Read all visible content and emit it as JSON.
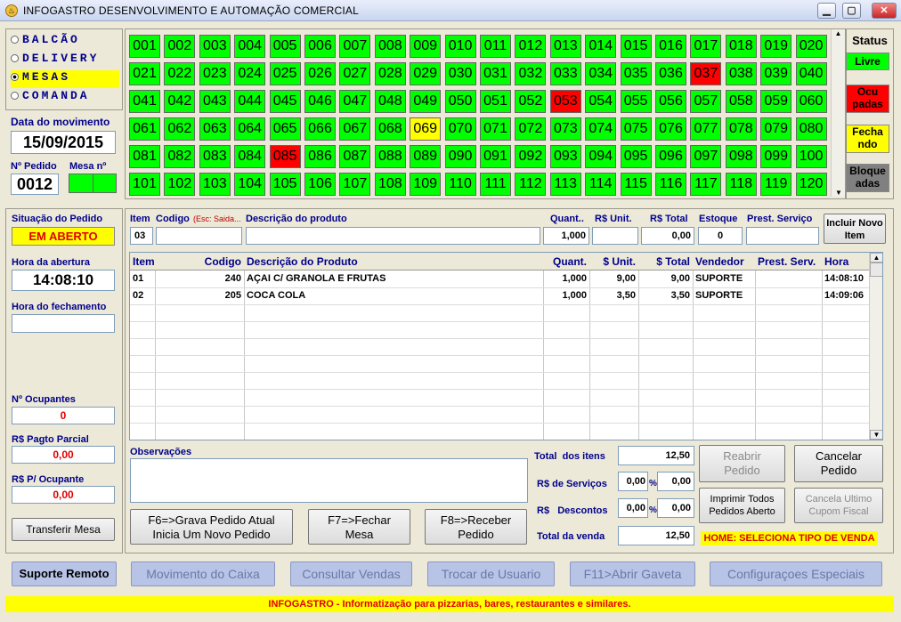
{
  "window": {
    "title": "INFOGASTRO DESENVOLVIMENTO E AUTOMAÇÃO COMERCIAL",
    "minimize": "▁",
    "maximize": "▢",
    "close": "✕",
    "icon": "app-logo-icon"
  },
  "mode": {
    "options": [
      "BALCÃO",
      "DELIVERY",
      "MESAS",
      "COMANDA"
    ],
    "selected": "MESAS"
  },
  "movimento": {
    "label": "Data do movimento",
    "date": "15/09/2015"
  },
  "pedido": {
    "num_label": "Nº Pedido",
    "num": "0012",
    "mesa_label": "Mesa nº"
  },
  "tables": {
    "numbers": [
      "001",
      "002",
      "003",
      "004",
      "005",
      "006",
      "007",
      "008",
      "009",
      "010",
      "011",
      "012",
      "013",
      "014",
      "015",
      "016",
      "017",
      "018",
      "019",
      "020",
      "021",
      "022",
      "023",
      "024",
      "025",
      "026",
      "027",
      "028",
      "029",
      "030",
      "031",
      "032",
      "033",
      "034",
      "035",
      "036",
      "037",
      "038",
      "039",
      "040",
      "041",
      "042",
      "043",
      "044",
      "045",
      "046",
      "047",
      "048",
      "049",
      "050",
      "051",
      "052",
      "053",
      "054",
      "055",
      "056",
      "057",
      "058",
      "059",
      "060",
      "061",
      "062",
      "063",
      "064",
      "065",
      "066",
      "067",
      "068",
      "069",
      "070",
      "071",
      "072",
      "073",
      "074",
      "075",
      "076",
      "077",
      "078",
      "079",
      "080",
      "081",
      "082",
      "083",
      "084",
      "085",
      "086",
      "087",
      "088",
      "089",
      "090",
      "091",
      "092",
      "093",
      "094",
      "095",
      "096",
      "097",
      "098",
      "099",
      "100",
      "101",
      "102",
      "103",
      "104",
      "105",
      "106",
      "107",
      "108",
      "109",
      "110",
      "111",
      "112",
      "113",
      "114",
      "115",
      "116",
      "117",
      "118",
      "119",
      "120"
    ],
    "occupied": [
      "037",
      "053",
      "085"
    ],
    "closing": [
      "069"
    ]
  },
  "status": {
    "title": "Status",
    "livre": "Livre",
    "ocupadas": "Ocu\npadas",
    "fechando": "Fecha\nndo",
    "bloqueadas": "Bloque\nadas",
    "colors": {
      "livre": "#00ff00",
      "ocupadas": "#ff0000",
      "fechando": "#ffff00",
      "bloqueadas": "#808080"
    }
  },
  "left": {
    "situacao_label": "Situação do Pedido",
    "situacao": "EM ABERTO",
    "abertura_label": "Hora da abertura",
    "abertura": "14:08:10",
    "fechamento_label": "Hora do fechamento",
    "fechamento": "",
    "ocupantes_label": "Nº Ocupantes",
    "ocupantes": "0",
    "pagto_label": "R$ Pagto Parcial",
    "pagto": "0,00",
    "por_ocupante_label": "R$ P/ Ocupante",
    "por_ocupante": "0,00",
    "transferir": "Transferir Mesa"
  },
  "entry": {
    "item_label": "Item",
    "item": "03",
    "codigo_label": "Codigo",
    "codigo_hint": "(Esc: Saida...",
    "descricao_label": "Descrição do produto",
    "quant_label": "Quant..",
    "quant": "1,000",
    "unit_label": "R$ Unit.",
    "unit": "",
    "total_label": "R$ Total",
    "total": "0,00",
    "estoque_label": "Estoque",
    "estoque": "0",
    "prest_label": "Prest. Serviço",
    "prest": "",
    "incluir": "Incluir Novo Item"
  },
  "grid": {
    "headers": [
      "Item",
      "Codigo",
      "Descrição do Produto",
      "Quant.",
      "$ Unit.",
      "$ Total",
      "Vendedor",
      "Prest. Serv.",
      "Hora"
    ],
    "rows": [
      [
        "01",
        "240",
        "AÇAI C/ GRANOLA E FRUTAS",
        "1,000",
        "9,00",
        "9,00",
        "SUPORTE",
        "",
        "14:08:10"
      ],
      [
        "02",
        "205",
        "COCA COLA",
        "1,000",
        "3,50",
        "3,50",
        "SUPORTE",
        "",
        "14:09:06"
      ]
    ]
  },
  "obs": {
    "label": "Observações",
    "value": ""
  },
  "totals": {
    "itens_label": "Total  dos itens",
    "itens": "12,50",
    "servicos_label": "R$ de Serviços",
    "servicos_pct": "0,00",
    "servicos": "0,00",
    "descontos_label": "R$   Descontos",
    "descontos_pct": "0,00",
    "descontos": "0,00",
    "venda_label": "Total da venda",
    "venda": "12,50",
    "pct": "%"
  },
  "actions": {
    "f6": "F6=>Grava Pedido Atual\nInicia Um Novo Pedido",
    "f7": "F7=>Fechar\nMesa",
    "f8": "F8=>Receber\nPedido",
    "reabrir": "Reabrir\nPedido",
    "cancelar": "Cancelar\nPedido",
    "imprimir": "Imprimir Todos\nPedidos Aberto",
    "cancela_cupom": "Cancela Ultimo\nCupom Fiscal",
    "home_hint": "HOME: SELECIONA TIPO DE VENDA"
  },
  "bottom": {
    "suporte": "Suporte Remoto",
    "caixa": "Movimento do Caixa",
    "consultar": "Consultar Vendas",
    "trocar": "Trocar de Usuario",
    "gaveta": "F11>Abrir Gaveta",
    "config": "Configuraçoes Especiais"
  },
  "footer": "INFOGASTRO - Informatização para pizzarias, bares, restaurantes e similares."
}
